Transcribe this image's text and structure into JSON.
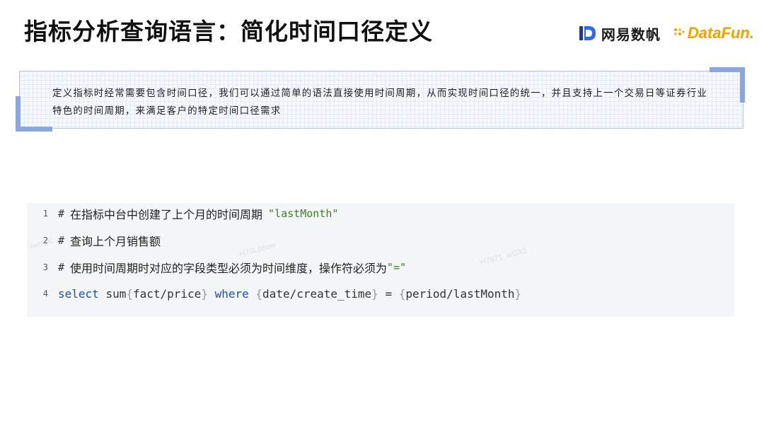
{
  "slide": {
    "title": "指标分析查询语言：简化时间口径定义",
    "logos": {
      "netease": "网易数帆",
      "datafun": "DataFun."
    },
    "callout_text": "定义指标时经常需要包含时间口径，我们可以通过简单的语法直接使用时间周期，从而实现时间口径的统一，并且支持上一个交易日等证券行业特色的时间周期，来满足客户的特定时间口径需求"
  },
  "code": {
    "lines": [
      {
        "num": "1",
        "hash": "#",
        "comment": "在指标中台中创建了上个月的时间周期",
        "string": "\"lastMonth\""
      },
      {
        "num": "2",
        "hash": "#",
        "comment": "查询上个月销售额"
      },
      {
        "num": "3",
        "hash": "#",
        "comment": "使用时间周期时对应的字段类型必须为时间维度，操作符必须为",
        "string": "\"=\""
      },
      {
        "num": "4",
        "kw_select": "select",
        "fn": "sum",
        "arg1": "fact/price",
        "kw_where": "where",
        "arg2": "date/create_time",
        "op": "=",
        "arg3": "period/lastMonth"
      }
    ],
    "braces": {
      "open": "{",
      "close": "}"
    }
  },
  "colors": {
    "accent_frame": "#8ca7df",
    "keyword": "#1a4fb5",
    "string": "#3f7d2b",
    "datafun_brand": "#f2a100",
    "code_bg": "#f4f5f7"
  }
}
